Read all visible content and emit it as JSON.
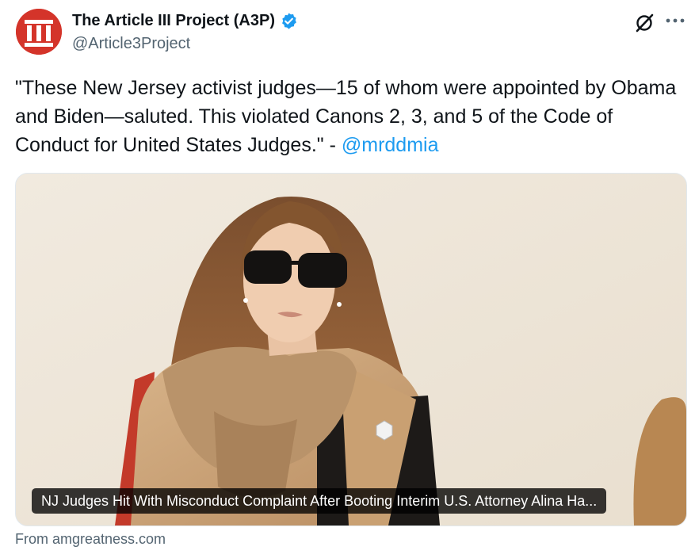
{
  "author": {
    "display_name": "The Article III Project (A3P)",
    "handle": "@Article3Project",
    "verified": true,
    "avatar_icon": "pillars-logo-icon",
    "avatar_color": "#d4342a"
  },
  "tweet": {
    "text_main": "\"These New Jersey activist judges—15 of whom were appointed by Obama and Biden—saluted. This violated Canons 2, 3, and 5 of the Code of Conduct for United States Judges.\" - ",
    "mention": "@mrddmia"
  },
  "link_card": {
    "headline": "NJ Judges Hit With Misconduct Complaint After Booting Interim U.S. Attorney Alina Ha...",
    "source": "From amgreatness.com"
  },
  "icons": {
    "grok": "grok-icon",
    "more": "more-options-icon",
    "verified": "verified-badge-icon"
  },
  "colors": {
    "link": "#1d9bf0",
    "verified": "#1d9bf0",
    "secondary_text": "#536471"
  }
}
